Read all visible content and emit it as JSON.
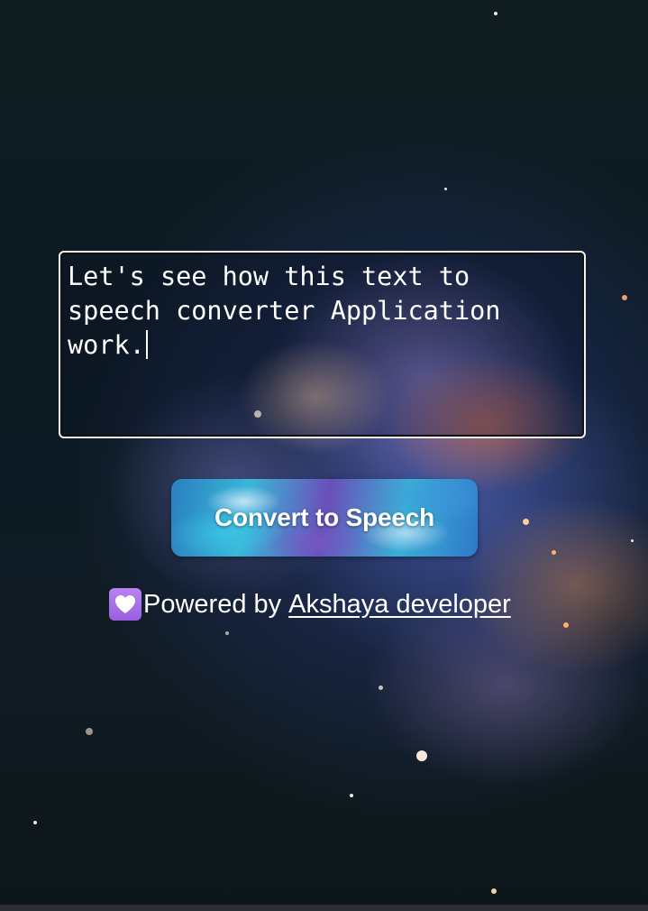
{
  "editor": {
    "text": "Let's see how this text to speech converter Application work."
  },
  "convert_button": {
    "label": "Convert to Speech"
  },
  "footer": {
    "powered_by": "Powered by",
    "developer_link": "Akshaya developer",
    "heart_icon": "white-heart-emoji"
  },
  "colors": {
    "background": "#0f1c20",
    "text": "#ffffff",
    "textbox_border": "#f2f2f2",
    "heart_badge": "#b784f0"
  }
}
